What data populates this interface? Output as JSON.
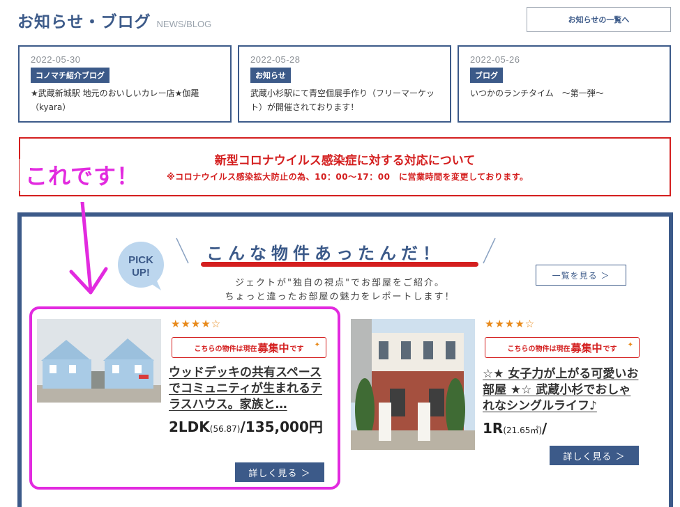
{
  "news": {
    "title": "お知らせ・ブログ",
    "title_en": "NEWS/BLOG",
    "list_button": "お知らせの一覧へ",
    "items": [
      {
        "date": "2022-05-30",
        "category": "コノマチ紹介ブログ",
        "headline": "★武蔵新城駅 地元のおいしいカレー店★伽羅（kyara）"
      },
      {
        "date": "2022-05-28",
        "category": "お知らせ",
        "headline": "武蔵小杉駅にて青空個展手作り（フリーマーケット）が開催されております！"
      },
      {
        "date": "2022-05-26",
        "category": "ブログ",
        "headline": "いつかのランチタイム　～第一弾～"
      }
    ]
  },
  "notice": {
    "title": "新型コロナウイルス感染症に対する対応について",
    "subtitle": "※コロナウイルス感染拡大防止の為、10：00～17：00　に営業時間を変更しております。"
  },
  "annotation": {
    "text": "これです！"
  },
  "pickup": {
    "badge_line1": "PICK",
    "badge_line2": "UP!",
    "heading": "こんな物件あったんだ！",
    "intro_line1": "ジェクトが\"独自の視点\"でお部屋をご紹介。",
    "intro_line2": "ちょっと違ったお部屋の魅力をレポートします！",
    "view_all": "一覧を見る ＞"
  },
  "properties": [
    {
      "stars": "★★★★☆",
      "rating": 4.5,
      "recruit_pre": "こちらの物件は現在",
      "recruit_big": "募集中",
      "recruit_post": "です",
      "spark": "✦",
      "title": "ウッドデッキの共有スペースでコミュニティが生まれるテラスハウス。家族と…",
      "layout": "2LDK",
      "area": "(56.87)",
      "price": "/135,000円",
      "detail": "詳しく見る ＞"
    },
    {
      "stars": "★★★★☆",
      "rating": 4.5,
      "recruit_pre": "こちらの物件は現在",
      "recruit_big": "募集中",
      "recruit_post": "です",
      "spark": "✦",
      "title": "☆★ 女子力が上がる可愛いお部屋 ★☆ 武蔵小杉でおしゃれなシングルライフ♪",
      "layout": "1R",
      "area": "(21.65㎡)",
      "price": "/",
      "detail": "詳しく見る ＞"
    }
  ],
  "colors": {
    "brand": "#3c5a89",
    "alert": "#d41f1f",
    "accent_star": "#e88a1b",
    "annotation": "#e22adf"
  }
}
